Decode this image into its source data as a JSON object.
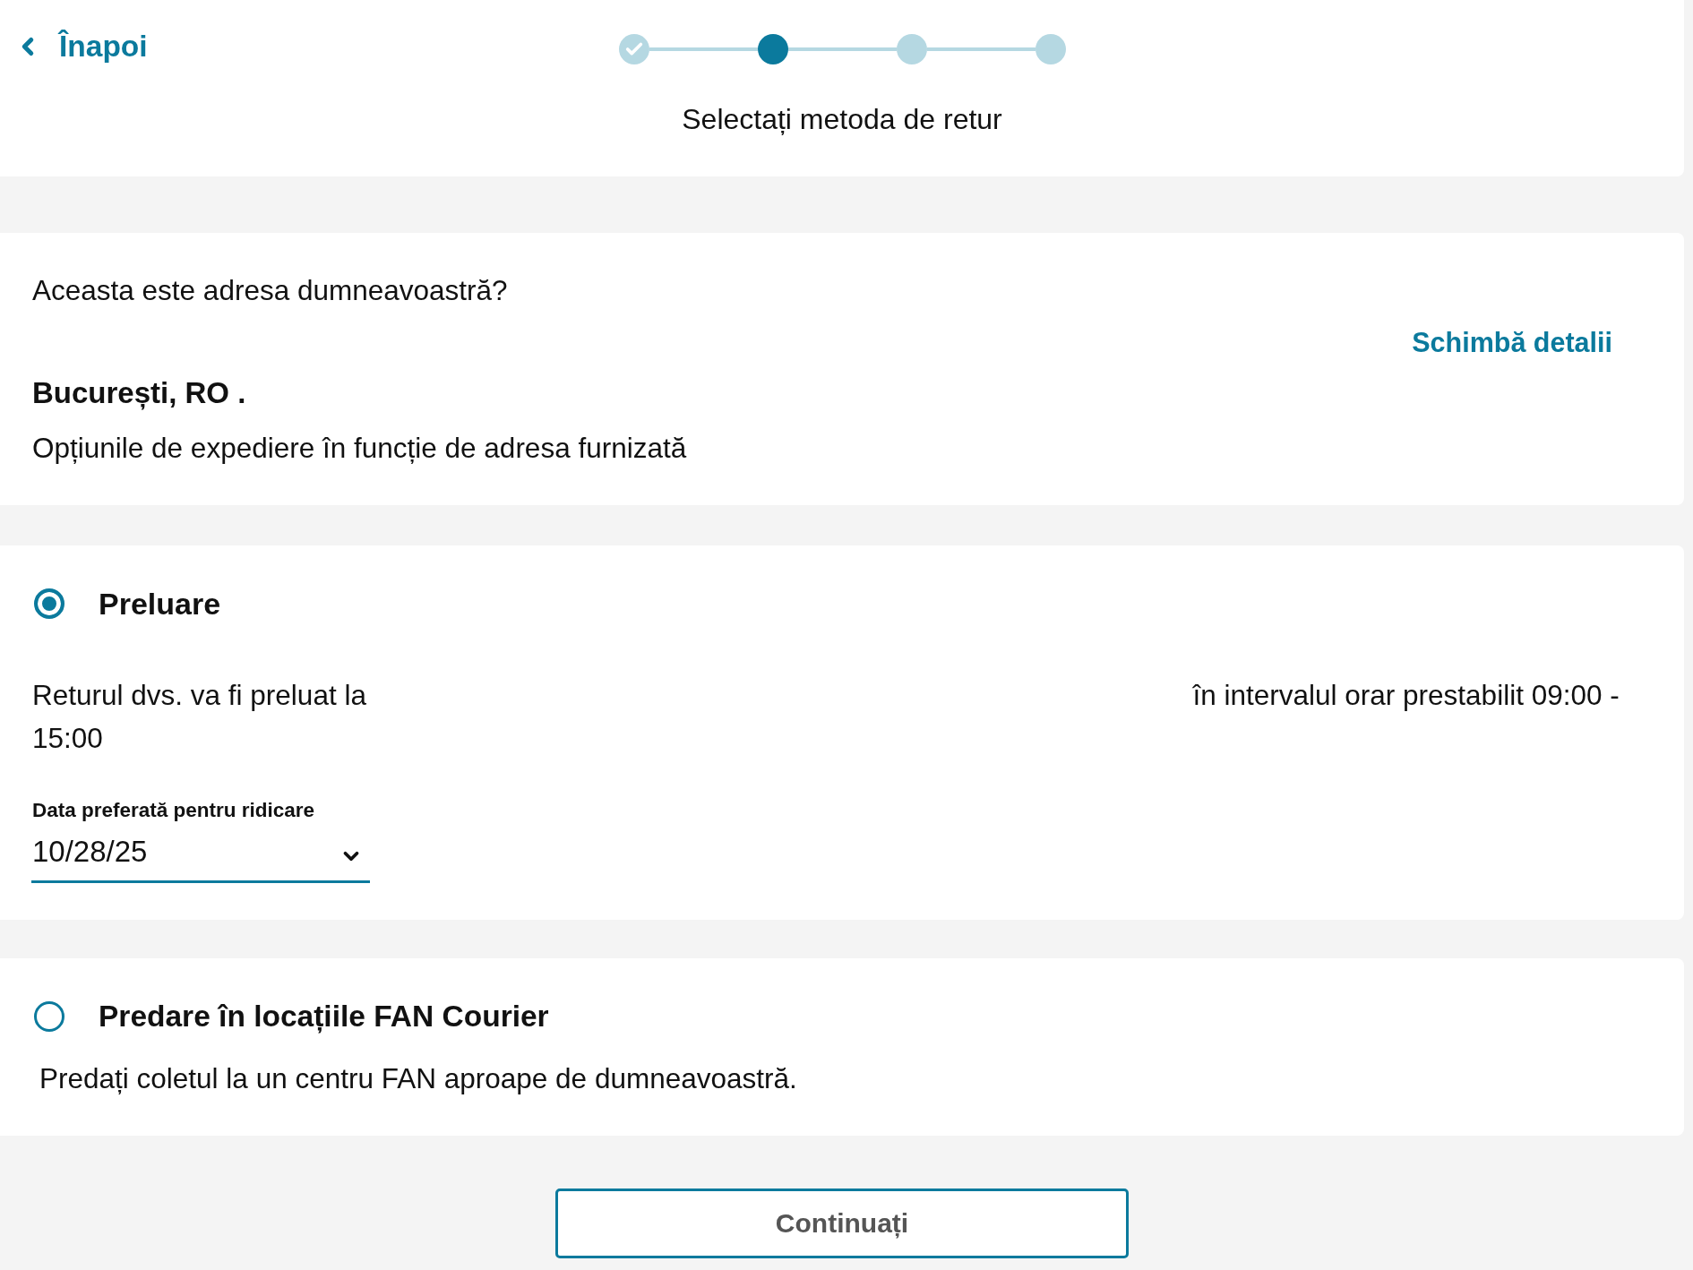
{
  "header": {
    "back_link": "Înapoi",
    "steps": [
      {
        "done": true,
        "selected": false
      },
      {
        "done": false,
        "selected": true
      },
      {
        "done": false,
        "selected": false
      },
      {
        "done": false,
        "selected": false
      }
    ],
    "title": "Selectați metoda de retur"
  },
  "address_card": {
    "question": "Aceasta este adresa dumneavoastră?",
    "change_link": "Schimbă detalii",
    "city": "București, RO .",
    "note": "Opțiunile de expediere în funcție de adresa furnizată"
  },
  "options": [
    {
      "kind": "pickup",
      "title": "Preluare",
      "selected": true,
      "description_before": "Returul dvs. va fi preluat la",
      "description_after": "în intervalul orar prestabilit 09:00 - 15:00",
      "date_field": {
        "label": "Data preferată pentru ridicare",
        "value": "10/28/25"
      }
    },
    {
      "kind": "dropoff",
      "title": "Predare în locațiile FAN Courier",
      "selected": false,
      "description": "Predați coletul la un centru FAN aproape de dumneavoastră."
    }
  ],
  "continue_button": "Continuați"
}
